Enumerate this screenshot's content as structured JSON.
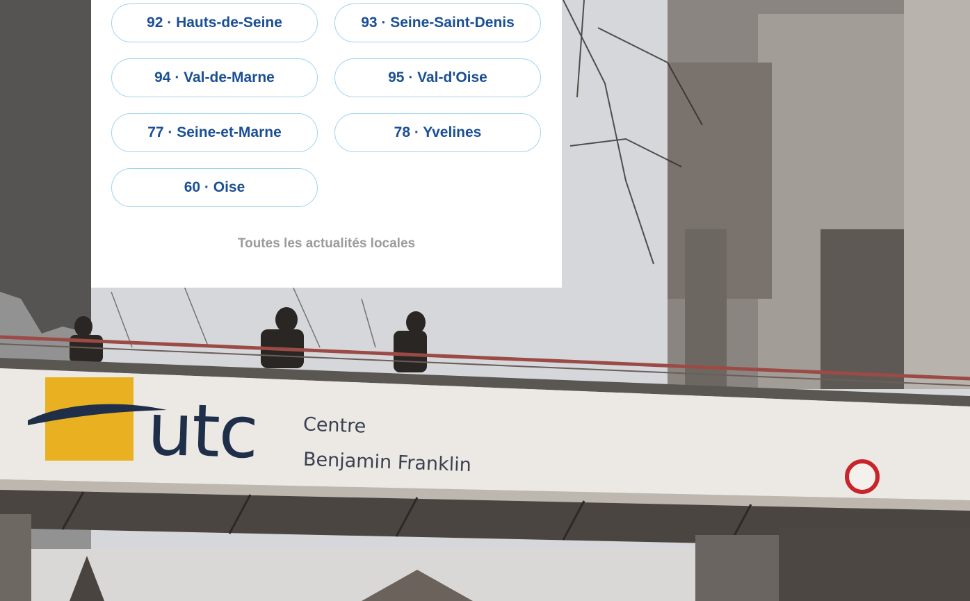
{
  "departments": [
    {
      "label": "92 · Hauts-de-Seine"
    },
    {
      "label": "93 · Seine-Saint-Denis"
    },
    {
      "label": "94 · Val-de-Marne"
    },
    {
      "label": "95 · Val-d'Oise"
    },
    {
      "label": "77 · Seine-et-Marne"
    },
    {
      "label": "78 · Yvelines"
    },
    {
      "label": "60 · Oise"
    }
  ],
  "all_news_link": "Toutes les actualités locales",
  "photo": {
    "sign_logo": "utc",
    "sign_line1": "Centre",
    "sign_line2": "Benjamin Franklin"
  },
  "colors": {
    "button_text": "#1a4f96",
    "button_border": "#9fd3ef",
    "link_text": "#9b9b9b",
    "logo_yellow": "#e9b021",
    "logo_navy": "#1f2f4a"
  }
}
